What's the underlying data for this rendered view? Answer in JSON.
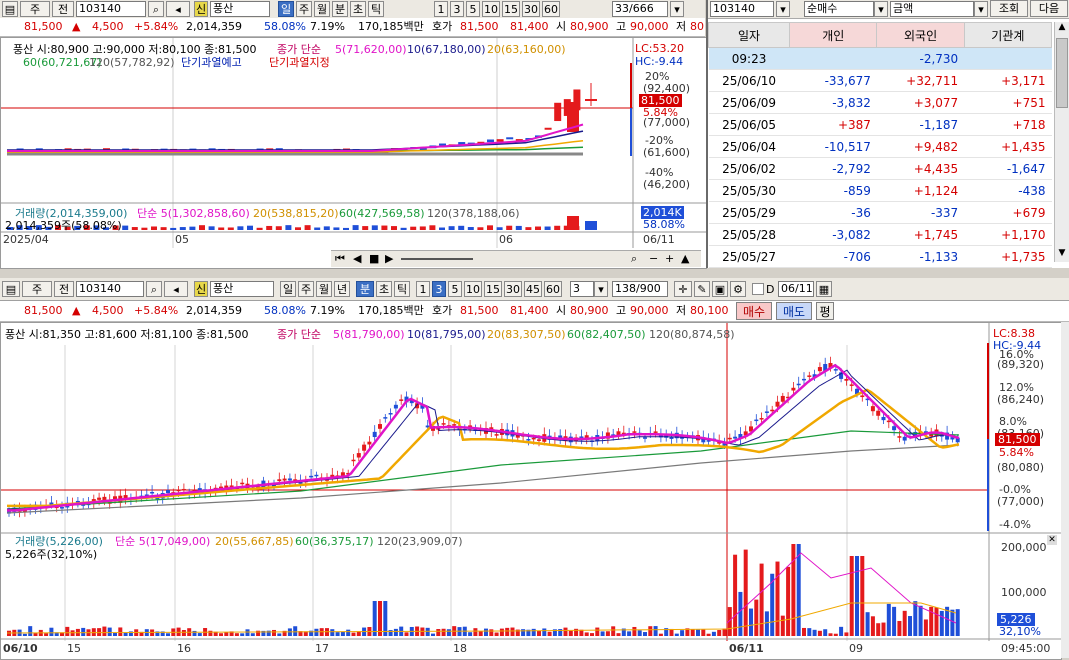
{
  "top_left": {
    "toolbar": {
      "tab1": "주",
      "tab2": "전",
      "code": "103140",
      "name": "풍산",
      "periods": [
        "일",
        "주",
        "월",
        "분",
        "초",
        "틱"
      ],
      "nums": [
        "1",
        "3",
        "5",
        "10",
        "15",
        "30",
        "45",
        "60"
      ],
      "count": "33/666"
    },
    "quote": {
      "price": "81,500",
      "arrow": "▲",
      "change": "4,500",
      "pct": "+5.84%",
      "volume": "2,014,359",
      "vol_ratio": "58.08%",
      "turnover": "7.19%",
      "amount": "170,185백만",
      "ask_label": "호가",
      "ask": "81,500",
      "bid": "81,400",
      "open_label": "시",
      "open": "80,900",
      "high_label": "고",
      "high": "90,000",
      "low_label": "저",
      "low": "80"
    },
    "price_legend": "풍산 시:80,900 고:90,000 저:80,100 종:81,500",
    "ma_legend": {
      "label": "종가 단순",
      "ma5": "5(71,620,00)",
      "ma10": "10(67,180,00)",
      "ma20": "20(63,160,00)",
      "ma60": "60(60,721,67)",
      "ma120": "120(57,782,92)"
    },
    "warn1": "단기과열예고",
    "warn2": "단기과열지정",
    "lc": "LC:53.20",
    "hc": "HC:-9.44",
    "right_axis": [
      "20%",
      "(92,400)",
      "81,500",
      "5.84%",
      "(77,000)",
      "-20%",
      "(61,600)",
      "-40%",
      "(46,200)"
    ],
    "vol_legend": {
      "label": "거래량(2,014,359,00)",
      "ma5": "단순 5(1,302,858,60)",
      "ma20": "20(538,815,20)",
      "ma60": "60(427,569,58)",
      "ma120": "120(378,188,06)"
    },
    "vol_sub": "2,014,359주(58.08%)",
    "vol_axis": [
      "2,014K",
      "58.08%"
    ],
    "x_labels": [
      "2025/04",
      "05",
      "06",
      "06/11"
    ]
  },
  "investor": {
    "select1": "순매수",
    "select2": "금액",
    "query_btn": "조회",
    "next_btn": "다음",
    "code": "103140",
    "headers": [
      "일자",
      "개인",
      "외국인",
      "기관계"
    ],
    "rows": [
      {
        "date": "09:23",
        "ind": "",
        "for": "-2,730",
        "inst": ""
      },
      {
        "date": "25/06/10",
        "ind": "-33,677",
        "for": "+32,711",
        "inst": "+3,171"
      },
      {
        "date": "25/06/09",
        "ind": "-3,832",
        "for": "+3,077",
        "inst": "+751"
      },
      {
        "date": "25/06/05",
        "ind": "+387",
        "for": "-1,187",
        "inst": "+718"
      },
      {
        "date": "25/06/04",
        "ind": "-10,517",
        "for": "+9,482",
        "inst": "+1,435"
      },
      {
        "date": "25/06/02",
        "ind": "-2,792",
        "for": "+4,435",
        "inst": "-1,647"
      },
      {
        "date": "25/05/30",
        "ind": "-859",
        "for": "+1,124",
        "inst": "-438"
      },
      {
        "date": "25/05/29",
        "ind": "-36",
        "for": "-337",
        "inst": "+679"
      },
      {
        "date": "25/05/28",
        "ind": "-3,082",
        "for": "+1,745",
        "inst": "+1,170"
      },
      {
        "date": "25/05/27",
        "ind": "-706",
        "for": "-1,133",
        "inst": "+1,735"
      }
    ]
  },
  "bottom": {
    "toolbar": {
      "tab1": "주",
      "tab2": "전",
      "code": "103140",
      "name": "풍산",
      "periods": [
        "일",
        "주",
        "월",
        "년",
        "분",
        "초",
        "틱"
      ],
      "nums": [
        "1",
        "3",
        "5",
        "10",
        "15",
        "30",
        "45",
        "60"
      ],
      "interval": "3",
      "count": "138/900",
      "date": "06/11",
      "d_label": "D"
    },
    "quote": {
      "price": "81,500",
      "arrow": "▲",
      "change": "4,500",
      "pct": "+5.84%",
      "volume": "2,014,359",
      "vol_ratio": "58.08%",
      "turnover": "7.19%",
      "amount": "170,185백만",
      "ask_label": "호가",
      "ask": "81,500",
      "bid": "81,400",
      "open_label": "시",
      "open": "80,900",
      "high_label": "고",
      "high": "90,000",
      "low_label": "저",
      "low": "80,100",
      "buy": "매수",
      "sell": "매도",
      "eval": "평"
    },
    "price_legend": "풍산 시:81,350 고:81,600 저:81,100 종:81,500",
    "ma_legend": {
      "label": "종가 단순",
      "ma5": "5(81,790,00)",
      "ma10": "10(81,795,00)",
      "ma20": "20(83,307,50)",
      "ma60": "60(82,407,50)",
      "ma120": "120(80,874,58)"
    },
    "lc": "LC:8.38",
    "hc": "HC:-9.44",
    "right_axis": [
      "16.0%",
      "(89,320)",
      "12.0%",
      "(86,240)",
      "8.0%",
      "(83,160)",
      "81,500",
      "5.84%",
      "(80,080)",
      "-0.0%",
      "(77,000)",
      "-4.0%"
    ],
    "vol_legend": {
      "label": "거래량(5,226,00)",
      "ma5": "단순 5(17,049,00)",
      "ma20": "20(55,667,85)",
      "ma60": "60(36,375,17)",
      "ma120": "120(23,909,07)"
    },
    "vol_sub": "5,226주(32,10%)",
    "vol_axis": [
      "200,000",
      "100,000",
      "5,226",
      "32,10%"
    ],
    "x_labels": [
      "06/10",
      "15",
      "16",
      "17",
      "18",
      "06/11",
      "09",
      "09:45:00"
    ]
  },
  "colors": {
    "up": "#e41a1c",
    "down": "#1f4fd8",
    "ma5": "#e014c8",
    "ma10": "#1a1a8c",
    "ma20": "#f0a800",
    "ma60": "#1a9a3a",
    "ma120": "#888888"
  }
}
